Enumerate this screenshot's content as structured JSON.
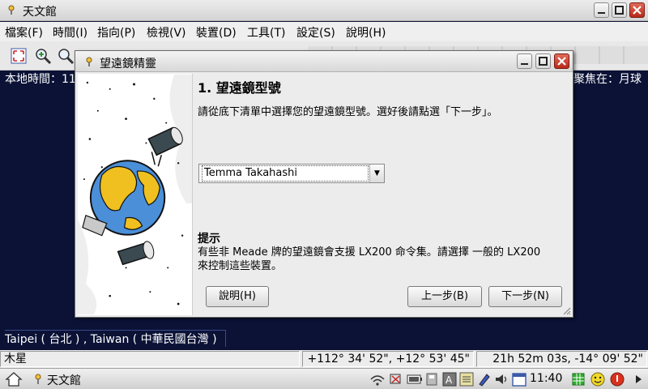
{
  "app": {
    "title": "天文館"
  },
  "menu": [
    {
      "label": "檔案(F)"
    },
    {
      "label": "時間(I)"
    },
    {
      "label": "指向(P)"
    },
    {
      "label": "檢視(V)"
    },
    {
      "label": "裝置(D)"
    },
    {
      "label": "工具(T)"
    },
    {
      "label": "設定(S)"
    },
    {
      "label": "說明(H)"
    }
  ],
  "sky": {
    "local_time": "本地時間：11",
    "focus": "聚焦在：月球",
    "location": "Taipei ( 台北 ) , Taiwan ( 中華民國台灣 )"
  },
  "status": {
    "object": "木星",
    "altaz": "+112° 34' 52\",  +12° 53' 45\"",
    "radec": "21h 52m 03s,  -14° 09' 52\""
  },
  "taskbar": {
    "app_label": "天文館",
    "clock": "11:40"
  },
  "dialog": {
    "title": "望遠鏡精靈",
    "heading": "1. 望遠鏡型號",
    "description": "請從底下清單中選擇您的望遠鏡型號。選好後請點選「下一步」。",
    "model_selected": "Temma Takahashi",
    "hint_title": "提示",
    "hint_line1": "有些非 Meade 牌的望遠鏡會支援 LX200 命令集。請選擇 一般的  LX200",
    "hint_line2": "來控制這些裝置。",
    "help_button": "說明(H)",
    "back_button": "上一步(B)",
    "next_button": "下一步(N)"
  },
  "colors": {
    "sky": "#0b1236",
    "close_button": "#c83a28"
  }
}
